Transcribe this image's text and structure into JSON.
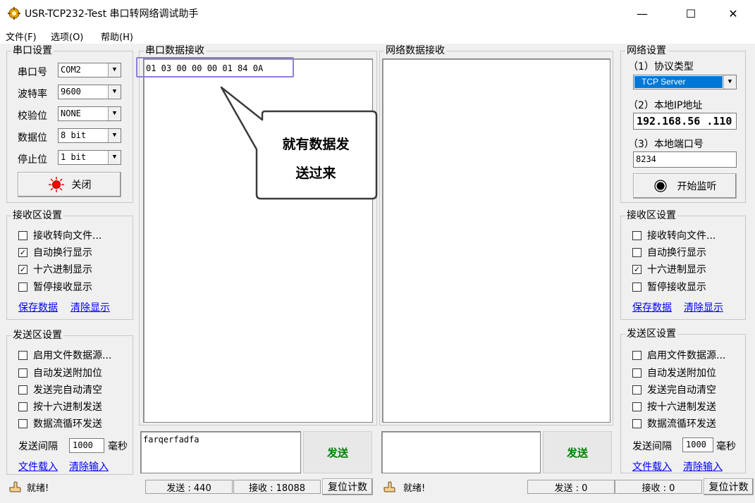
{
  "window": {
    "title": "USR-TCP232-Test 串口转网络调试助手",
    "minimize": "—",
    "maximize": "☐",
    "close": "✕"
  },
  "menu": [
    {
      "label": "文件(F)"
    },
    {
      "label": "选项(O)"
    },
    {
      "label": "帮助(H)"
    }
  ],
  "serial_settings": {
    "title": "串口设置",
    "rows": [
      {
        "label": "串口号",
        "value": "COM2"
      },
      {
        "label": "波特率",
        "value": "9600"
      },
      {
        "label": "校验位",
        "value": "NONE"
      },
      {
        "label": "数据位",
        "value": "8 bit"
      },
      {
        "label": "停止位",
        "value": "1 bit"
      }
    ],
    "close_button": "关闭"
  },
  "serial_receive_settings": {
    "title": "接收区设置",
    "options": [
      {
        "label": "接收转向文件...",
        "checked": ""
      },
      {
        "label": "自动换行显示",
        "checked": "✓"
      },
      {
        "label": "十六进制显示",
        "checked": "✓"
      },
      {
        "label": "暂停接收显示",
        "checked": ""
      }
    ],
    "save_link": "保存数据",
    "clear_link": "清除显示"
  },
  "serial_send_settings": {
    "title": "发送区设置",
    "options": [
      {
        "label": "启用文件数据源...",
        "checked": ""
      },
      {
        "label": "自动发送附加位",
        "checked": ""
      },
      {
        "label": "发送完自动清空",
        "checked": ""
      },
      {
        "label": "按十六进制发送",
        "checked": ""
      },
      {
        "label": "数据流循环发送",
        "checked": ""
      }
    ],
    "interval_label": "发送间隔",
    "interval_value": "1000",
    "interval_unit": "毫秒",
    "load_link": "文件载入",
    "clear_link": "清除输入"
  },
  "serial_receive": {
    "title": "串口数据接收",
    "content": "01 03 00 00 00 01 84 0A"
  },
  "network_receive": {
    "title": "网络数据接收",
    "content": ""
  },
  "serial_send": {
    "input": "farqerfadfa",
    "button": "发送"
  },
  "network_send": {
    "input": "",
    "button": "发送"
  },
  "callout": {
    "line1": "就有数据发",
    "line2": "送过来"
  },
  "network_settings": {
    "title": "网络设置",
    "protocol_label": "（1）协议类型",
    "protocol_value": "TCP Server",
    "ip_label": "（2）本地IP地址",
    "ip_value": "192.168.56 .110",
    "port_label": "（3）本地端口号",
    "port_value": "8234",
    "listen_button": "开始监听"
  },
  "network_receive_settings": {
    "title": "接收区设置",
    "options": [
      {
        "label": "接收转向文件...",
        "checked": ""
      },
      {
        "label": "自动换行显示",
        "checked": ""
      },
      {
        "label": "十六进制显示",
        "checked": "✓"
      },
      {
        "label": "暂停接收显示",
        "checked": ""
      }
    ],
    "save_link": "保存数据",
    "clear_link": "清除显示"
  },
  "network_send_settings": {
    "title": "发送区设置",
    "options": [
      {
        "label": "启用文件数据源...",
        "checked": ""
      },
      {
        "label": "自动发送附加位",
        "checked": ""
      },
      {
        "label": "发送完自动清空",
        "checked": ""
      },
      {
        "label": "按十六进制发送",
        "checked": ""
      },
      {
        "label": "数据流循环发送",
        "checked": ""
      }
    ],
    "interval_label": "发送间隔",
    "interval_value": "1000",
    "interval_unit": "毫秒",
    "load_link": "文件载入",
    "clear_link": "清除输入"
  },
  "status_left": {
    "ready": "就绪!",
    "sent": "发送 : 440",
    "received": "接收 : 18088",
    "reset": "复位计数"
  },
  "status_right": {
    "ready": "就绪!",
    "sent": "发送 : 0",
    "received": "接收 : 0",
    "reset": "复位计数"
  },
  "colors": {
    "accent_border": "#8a7fd8",
    "send_text": "#008000",
    "link": "#0000ff",
    "led_red": "#ff0000"
  }
}
